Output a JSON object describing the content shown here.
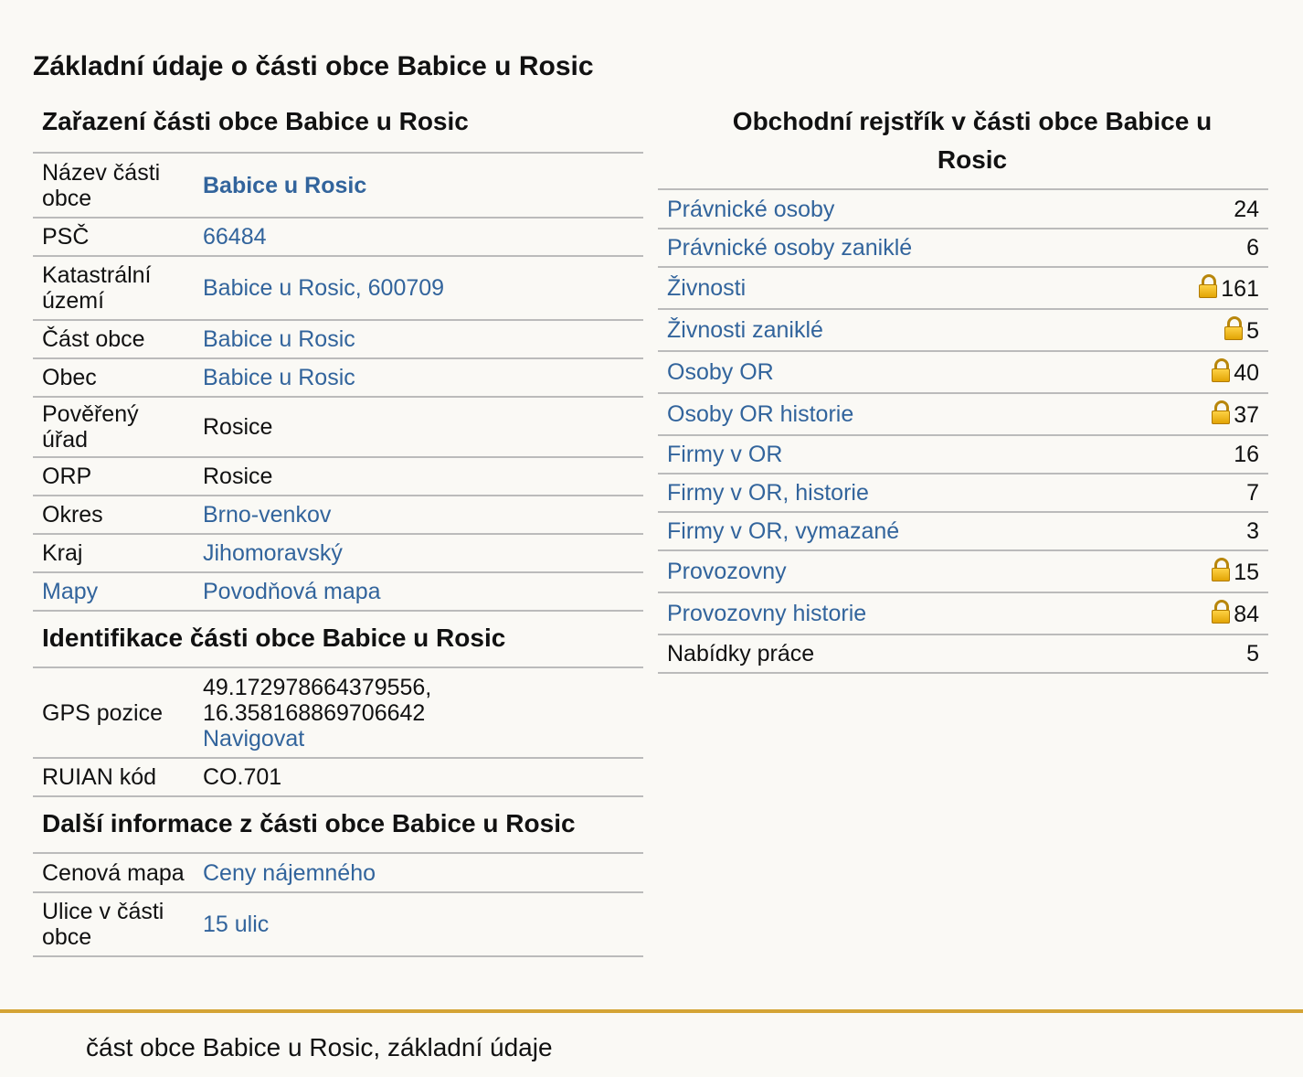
{
  "page_title": "Základní údaje o části obce Babice u Rosic",
  "classification": {
    "heading": "Zařazení části obce Babice u Rosic",
    "rows": [
      {
        "label": "Název části obce",
        "value": "Babice u Rosic"
      },
      {
        "label": "PSČ",
        "value": "66484"
      },
      {
        "label": "Katastrální území",
        "value": "Babice u Rosic, 600709"
      },
      {
        "label": "Část obce",
        "value": "Babice u Rosic"
      },
      {
        "label": "Obec",
        "value": "Babice u Rosic"
      },
      {
        "label": "Pověřený úřad",
        "value": "Rosice"
      },
      {
        "label": "ORP",
        "value": "Rosice"
      },
      {
        "label": "Okres",
        "value": "Brno-venkov"
      },
      {
        "label": "Kraj",
        "value": "Jihomoravský"
      },
      {
        "label": "Mapy",
        "value": "Povodňová mapa"
      }
    ]
  },
  "identification": {
    "heading": "Identifikace části obce Babice u Rosic",
    "gps_label": "GPS pozice",
    "gps_lat": "49.172978664379556,",
    "gps_lon": "16.358168869706642",
    "gps_link": "Navigovat",
    "ruian_label": "RUIAN kód",
    "ruian_value": "CO.701"
  },
  "more_info": {
    "heading": "Další informace z části obce Babice u Rosic",
    "rows": [
      {
        "label": "Cenová mapa",
        "value": "Ceny nájemného"
      },
      {
        "label": "Ulice v části obce",
        "value": "15 ulic"
      }
    ]
  },
  "registry": {
    "heading": "Obchodní rejstřík v části obce Babice u Rosic",
    "lock_icon": "padlock-icon",
    "rows": [
      {
        "label": "Právnické osoby",
        "count": "24",
        "locked": false,
        "link": true
      },
      {
        "label": "Právnické osoby zaniklé",
        "count": "6",
        "locked": false,
        "link": true
      },
      {
        "label": "Živnosti",
        "count": "161",
        "locked": true,
        "link": true
      },
      {
        "label": "Živnosti zaniklé",
        "count": "5",
        "locked": true,
        "link": true
      },
      {
        "label": "Osoby OR",
        "count": "40",
        "locked": true,
        "link": true
      },
      {
        "label": "Osoby OR historie",
        "count": "37",
        "locked": true,
        "link": true
      },
      {
        "label": "Firmy v OR",
        "count": "16",
        "locked": false,
        "link": true
      },
      {
        "label": "Firmy v OR, historie",
        "count": "7",
        "locked": false,
        "link": true
      },
      {
        "label": "Firmy v OR, vymazané",
        "count": "3",
        "locked": false,
        "link": true
      },
      {
        "label": "Provozovny",
        "count": "15",
        "locked": true,
        "link": true
      },
      {
        "label": "Provozovny historie",
        "count": "84",
        "locked": true,
        "link": true
      },
      {
        "label": "Nabídky práce",
        "count": "5",
        "locked": false,
        "link": false
      }
    ]
  },
  "footer": {
    "text": "část obce Babice u Rosic, základní údaje"
  },
  "colors": {
    "link": "#32649c",
    "background": "#faf9f5",
    "footer_border": "#d4a435",
    "lock": "#e0a100"
  }
}
